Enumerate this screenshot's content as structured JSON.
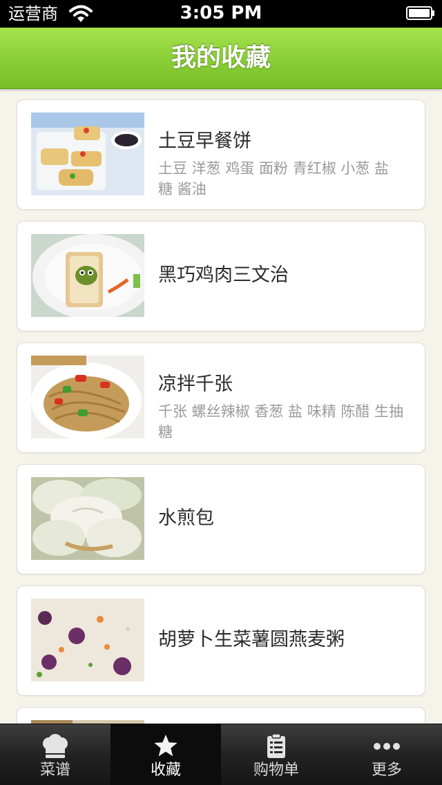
{
  "status_bar": {
    "carrier": "运营商",
    "time": "3:05 PM"
  },
  "nav": {
    "title": "我的收藏"
  },
  "recipes": [
    {
      "name": "土豆早餐饼",
      "ingredients": "土豆 洋葱 鸡蛋 面粉 青红椒 小葱 盐 糖 酱油"
    },
    {
      "name": "黑巧鸡肉三文治",
      "ingredients": ""
    },
    {
      "name": "凉拌千张",
      "ingredients": "千张 螺丝辣椒 香葱 盐 味精 陈醋 生抽 糖"
    },
    {
      "name": "水煎包",
      "ingredients": ""
    },
    {
      "name": "胡萝卜生菜薯圆燕麦粥",
      "ingredients": ""
    }
  ],
  "tabs": [
    {
      "label": "菜谱",
      "icon": "chef-hat-icon"
    },
    {
      "label": "收藏",
      "icon": "star-icon",
      "active": true
    },
    {
      "label": "购物单",
      "icon": "clipboard-list-icon"
    },
    {
      "label": "更多",
      "icon": "more-dots-icon"
    }
  ],
  "colors": {
    "nav_green": "#8ed23a",
    "tab_bar": "#232323",
    "page_bg": "#f6f4ea"
  }
}
